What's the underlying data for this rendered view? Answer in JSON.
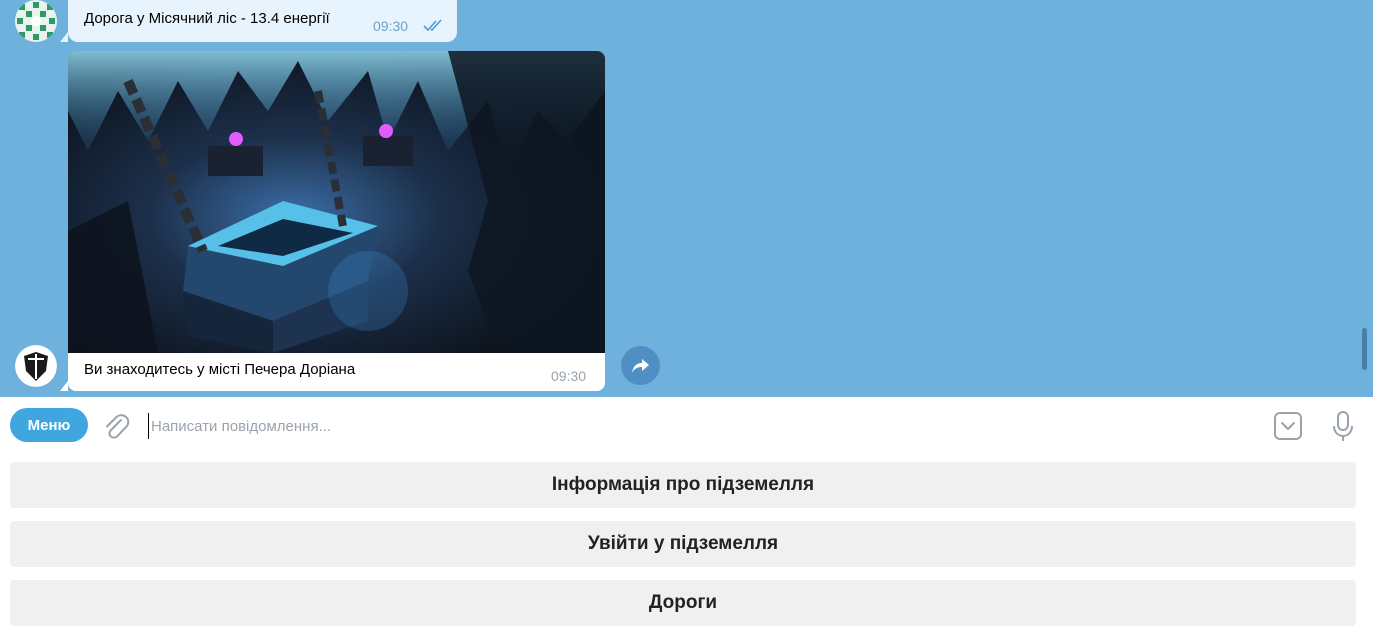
{
  "messages": {
    "outgoing": {
      "text": "Дорога у Місячний ліс - 13.4 енергії",
      "time": "09:30",
      "status_icon": "double-check-icon"
    },
    "incoming": {
      "text": "Ви знаходитесь у місті Печера Доріана",
      "time": "09:30",
      "photo": "dungeon-cave-image"
    }
  },
  "composer": {
    "menu_label": "Меню",
    "placeholder": "Написати повідомлення...",
    "value": ""
  },
  "keyboard": {
    "buttons": [
      {
        "label": "Інформація про підземелля"
      },
      {
        "label": "Увійти у підземелля"
      },
      {
        "label": "Дороги"
      }
    ]
  },
  "colors": {
    "chat_bg": "#6fb1dd",
    "outgoing_bubble": "#e8f4fd",
    "accent": "#3fa6e0"
  }
}
